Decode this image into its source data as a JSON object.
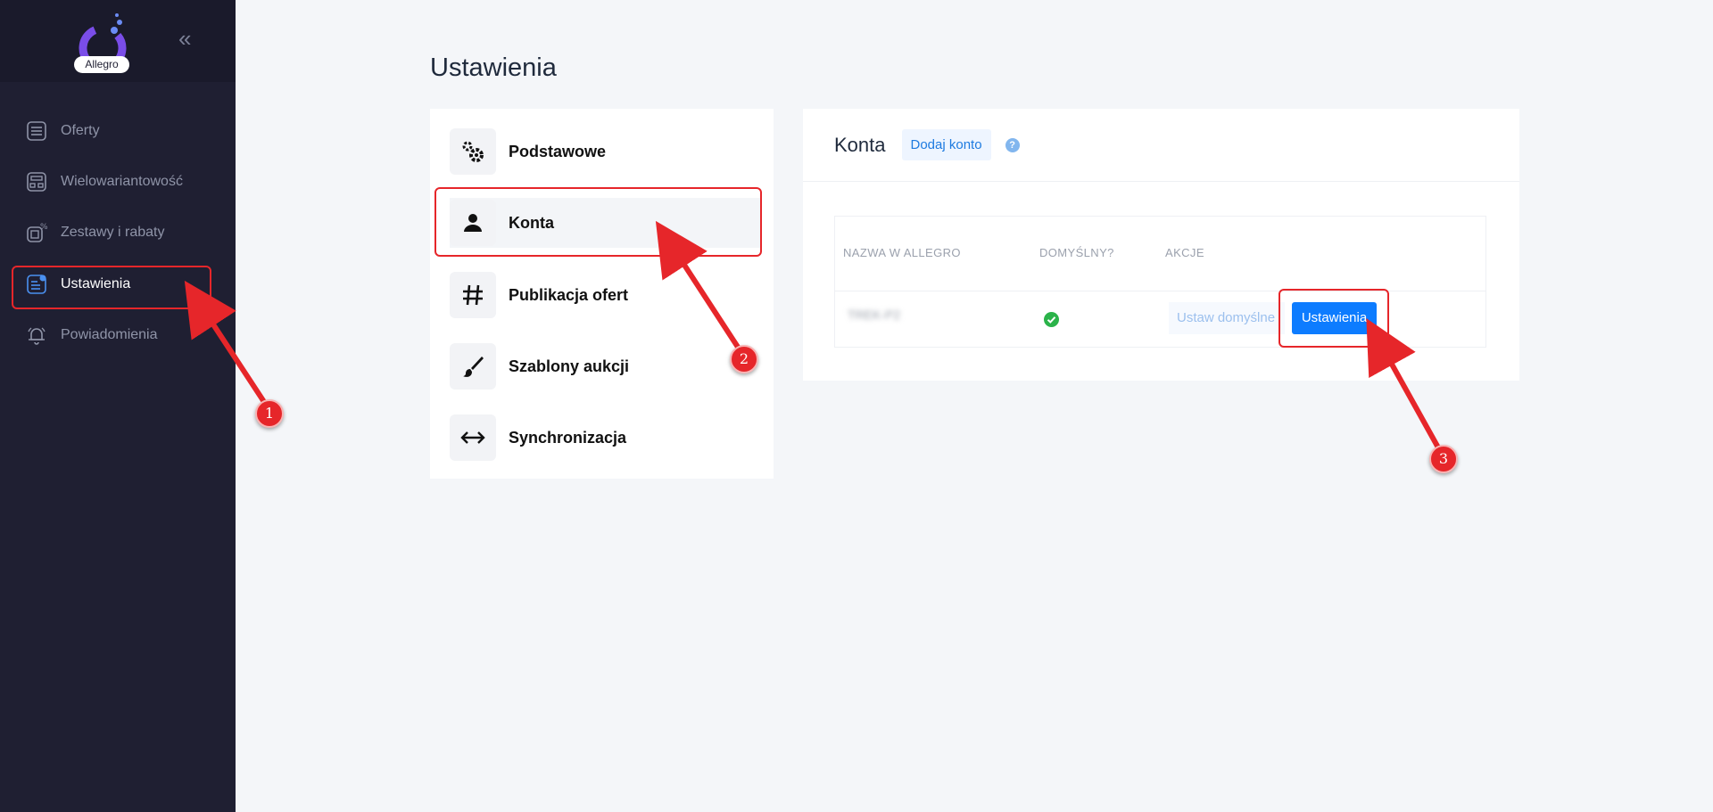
{
  "app": {
    "logo_text": "Allegro"
  },
  "sidebar": {
    "items": [
      {
        "label": "Oferty",
        "icon": "list-icon"
      },
      {
        "label": "Wielowariantowość",
        "icon": "variants-icon"
      },
      {
        "label": "Zestawy i rabaty",
        "icon": "discount-icon"
      },
      {
        "label": "Ustawienia",
        "icon": "settings-icon",
        "active": true
      },
      {
        "label": "Powiadomienia",
        "icon": "bell-icon"
      }
    ]
  },
  "page": {
    "title": "Ustawienia"
  },
  "settings_menu": {
    "items": [
      {
        "label": "Podstawowe",
        "icon": "gears-icon"
      },
      {
        "label": "Konta",
        "icon": "user-icon",
        "active": true
      },
      {
        "label": "Publikacja ofert",
        "icon": "hashtag-icon"
      },
      {
        "label": "Szablony aukcji",
        "icon": "brush-icon"
      },
      {
        "label": "Synchronizacja",
        "icon": "arrows-horizontal-icon"
      }
    ]
  },
  "accounts": {
    "title": "Konta",
    "add_button": "Dodaj konto",
    "help": "?",
    "columns": [
      "NAZWA W ALLEGRO",
      "DOMYŚLNY?",
      "AKCJE"
    ],
    "rows": [
      {
        "name": "TREK-P2",
        "default": true,
        "set_default_label": "Ustaw domyślne",
        "settings_label": "Ustawienia"
      }
    ]
  },
  "annotations": [
    "1",
    "2",
    "3"
  ],
  "colors": {
    "sidebar_bg": "#1f1f32",
    "accent": "#0d7cff",
    "highlight": "#e6262a",
    "success": "#2bb34a"
  }
}
